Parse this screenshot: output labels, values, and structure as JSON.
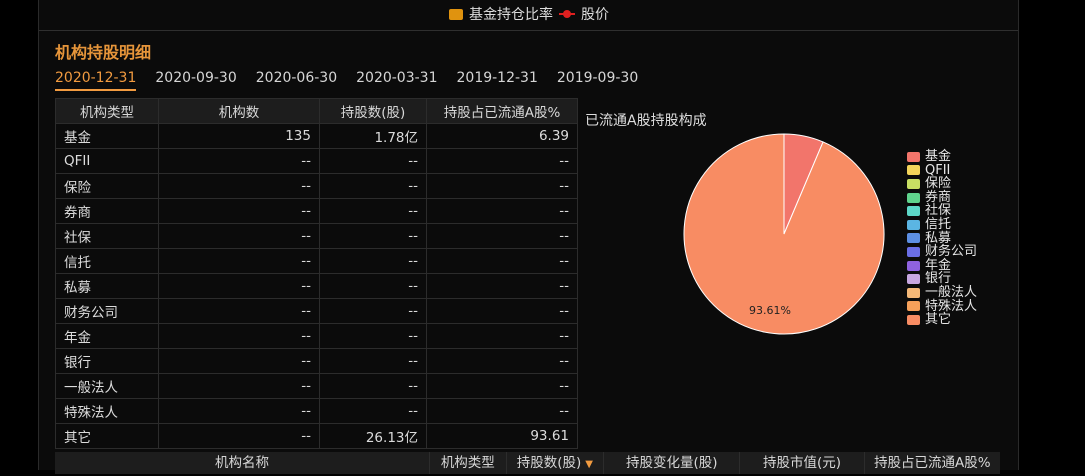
{
  "legend_top": {
    "bar_label": "基金持仓比率",
    "line_label": "股价"
  },
  "section_title": "机构持股明细",
  "tabs": [
    "2020-12-31",
    "2020-09-30",
    "2020-06-30",
    "2020-03-31",
    "2019-12-31",
    "2019-09-30"
  ],
  "table": {
    "headers": [
      "机构类型",
      "机构数",
      "持股数(股)",
      "持股占已流通A股%"
    ],
    "rows": [
      [
        "基金",
        "135",
        "1.78亿",
        "6.39"
      ],
      [
        "QFII",
        "--",
        "--",
        "--"
      ],
      [
        "保险",
        "--",
        "--",
        "--"
      ],
      [
        "券商",
        "--",
        "--",
        "--"
      ],
      [
        "社保",
        "--",
        "--",
        "--"
      ],
      [
        "信托",
        "--",
        "--",
        "--"
      ],
      [
        "私募",
        "--",
        "--",
        "--"
      ],
      [
        "财务公司",
        "--",
        "--",
        "--"
      ],
      [
        "年金",
        "--",
        "--",
        "--"
      ],
      [
        "银行",
        "--",
        "--",
        "--"
      ],
      [
        "一般法人",
        "--",
        "--",
        "--"
      ],
      [
        "特殊法人",
        "--",
        "--",
        "--"
      ],
      [
        "其它",
        "--",
        "26.13亿",
        "93.61"
      ]
    ]
  },
  "chart_data": {
    "type": "pie",
    "title": "已流通A股持股构成",
    "slices": [
      {
        "name": "基金",
        "value": 6.39,
        "color": "#f2756b"
      },
      {
        "name": "其它",
        "value": 93.61,
        "color": "#f88c63"
      }
    ],
    "data_labels": [
      "93.61%"
    ]
  },
  "pie_legend": [
    {
      "name": "基金",
      "color": "#f2756b"
    },
    {
      "name": "QFII",
      "color": "#f3d45a"
    },
    {
      "name": "保险",
      "color": "#c8df63"
    },
    {
      "name": "券商",
      "color": "#5fd38c"
    },
    {
      "name": "社保",
      "color": "#5dd8c8"
    },
    {
      "name": "信托",
      "color": "#5bb5e3"
    },
    {
      "name": "私募",
      "color": "#5d8fe3"
    },
    {
      "name": "财务公司",
      "color": "#6a6ee6"
    },
    {
      "name": "年金",
      "color": "#8f62df"
    },
    {
      "name": "银行",
      "color": "#c7a7e0"
    },
    {
      "name": "一般法人",
      "color": "#f4b878"
    },
    {
      "name": "特殊法人",
      "color": "#f6a05a"
    },
    {
      "name": "其它",
      "color": "#f88c63"
    }
  ],
  "bottom_headers": [
    "机构名称",
    "机构类型",
    "持股数(股)",
    "持股变化量(股)",
    "持股市值(元)",
    "持股占已流通A股%"
  ]
}
